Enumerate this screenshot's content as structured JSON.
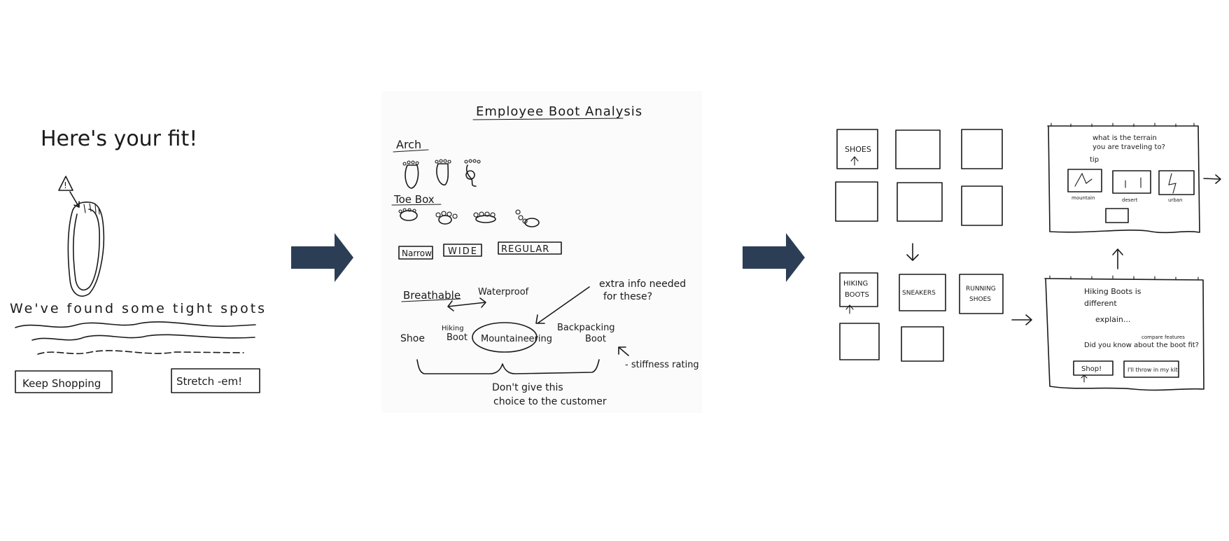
{
  "colors": {
    "accent_arrow": "#2c3e55",
    "ink": "#1a1a1a",
    "paper": "#ffffff"
  },
  "sketch1": {
    "title": "Here's your fit!",
    "warning_symbol": "!",
    "message": "We've found some tight spots",
    "btn_keep": "Keep Shopping",
    "btn_stretch": "Stretch -em!"
  },
  "sketch2": {
    "title": "Employee Boot Analysis",
    "arch": "Arch",
    "toe_box": "Toe Box",
    "narrow": "Narrow",
    "wide": "WIDE",
    "regular": "REGULAR",
    "breathable": "Breathable",
    "waterproof": "Waterproof",
    "extra_info_1": "extra info needed",
    "extra_info_2": "for these?",
    "shoe": "Shoe",
    "hiking_1": "Hiking",
    "hiking_2": "Boot",
    "mountaineering": "Mountaineering",
    "backpacking_1": "Backpacking",
    "backpacking_2": "Boot",
    "stiffness": "- stiffness rating",
    "note_1": "Don't give this",
    "note_2": "choice to the customer"
  },
  "sketch3": {
    "shoes": "SHOES",
    "hiking_boots_1": "HIKING",
    "hiking_boots_2": "BOOTS",
    "sneakers": "SNEAKERS",
    "running_1": "RUNNING",
    "running_2": "SHOES",
    "terrain_1": "what is the terrain",
    "terrain_2": "you are traveling to?",
    "terrain_3": "tip",
    "opt_mountain": "mountain",
    "opt_desert": "desert",
    "opt_urban": "urban",
    "hb_1": "Hiking Boots is",
    "hb_2": "different",
    "hb_3": "explain...",
    "hb_4": "Did you know about the boot fit?",
    "hb_small": "compare features",
    "hb_btn1": "Shop!",
    "hb_btn2": "I'll throw in my kit"
  }
}
